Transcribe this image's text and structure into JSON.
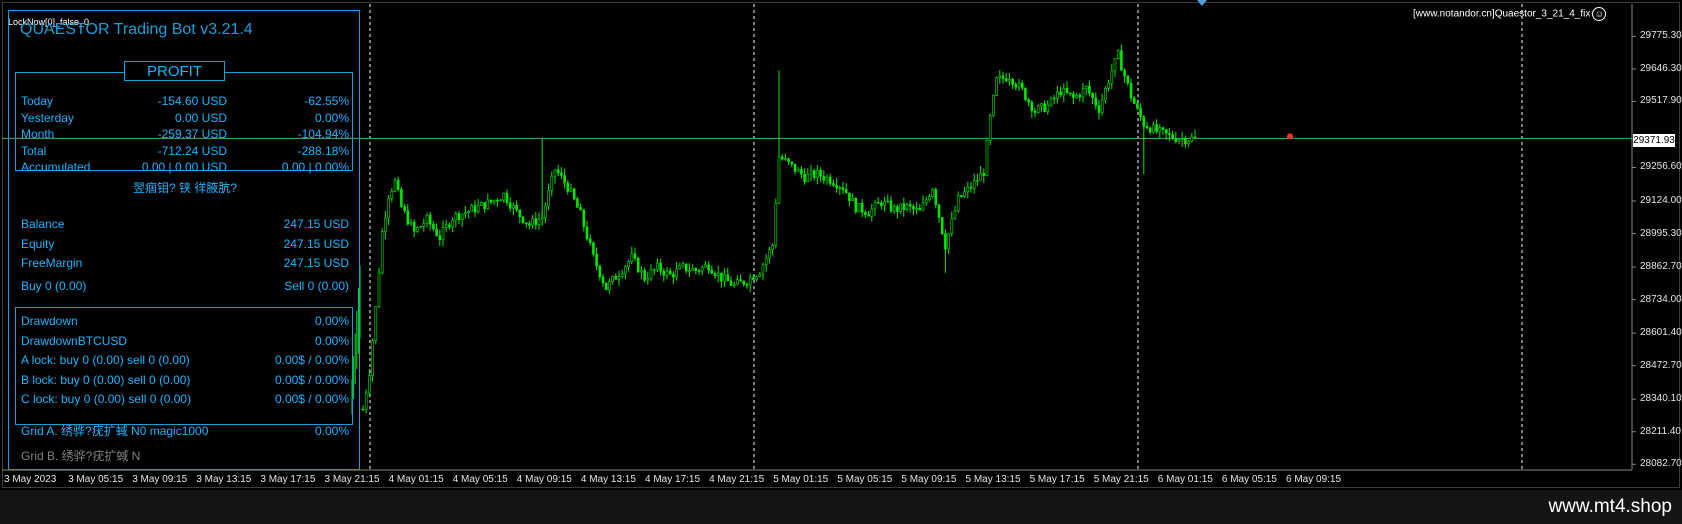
{
  "window": {
    "lock_status": "LockNow[0]_false_0",
    "top_right_label": "[www.notandor.cn]Quaestor_3_21_4_fix",
    "current_price": "29371.93",
    "watermark": "www.mt4.shop"
  },
  "panel": {
    "title": "QUAESTOR Trading Bot v3.21.4",
    "profit_header": "PROFIT",
    "profit_rows": [
      {
        "label": "Today",
        "value": "-154.60 USD",
        "percent": "-62.55%"
      },
      {
        "label": "Yesterday",
        "value": "0.00 USD",
        "percent": "0.00%"
      },
      {
        "label": "Month",
        "value": "-259.37 USD",
        "percent": "-104.94%"
      },
      {
        "label": "Total",
        "value": "-712.24 USD",
        "percent": "-288.18%"
      },
      {
        "label": "Accumulated",
        "value": "0.00 | 0.00 USD",
        "percent": "0.00 | 0.00%"
      }
    ],
    "garbled_line": "翌痼钼? 铗 徉腋肮?",
    "account_rows": [
      {
        "label": "Balance",
        "value": "247.15 USD"
      },
      {
        "label": "Equity",
        "value": "247.15 USD"
      },
      {
        "label": "FreeMargin",
        "value": "247.15 USD"
      }
    ],
    "buy_label": "Buy 0   (0.00)",
    "sell_label": "Sell 0   (0.00)",
    "drawdown_rows": [
      {
        "label": "Drawdown",
        "value": "0.00%"
      },
      {
        "label": "DrawdownBTCUSD",
        "value": "0.00%"
      },
      {
        "label": "A lock: buy 0 (0.00) sell 0 (0.00)",
        "value": "0.00$ / 0.00%"
      },
      {
        "label": "B lock: buy 0 (0.00) sell 0 (0.00)",
        "value": "0.00$ / 0.00%"
      },
      {
        "label": "C lock: buy 0 (0.00) sell 0 (0.00)",
        "value": "0.00$ / 0.00%"
      }
    ],
    "grid_a_label": "Grid A. 绣骅?疣扩蜮 N0 magic1000",
    "grid_a_value": "0.00%",
    "grid_b_label": "Grid B. 绣骅?疣扩蜮 N"
  },
  "colors": {
    "background": "#000000",
    "candle": "#00e600",
    "panel_text": "#1ab4ff",
    "panel_border": "#1a9ed8",
    "price_line": "#3cb371",
    "grid": "#ffffff"
  },
  "chart_data": {
    "type": "candlestick",
    "symbol_timeframe": "M15",
    "price_axis": [
      "29775.30",
      "29646.30",
      "29517.90",
      "29256.60",
      "29124.00",
      "28995.30",
      "28862.70",
      "28734.00",
      "28601.40",
      "28472.70",
      "28340.10",
      "28211.40",
      "28082.70"
    ],
    "time_axis": [
      "3 May 2023",
      "3 May 05:15",
      "3 May 09:15",
      "3 May 13:15",
      "3 May 17:15",
      "3 May 21:15",
      "4 May 01:15",
      "4 May 05:15",
      "4 May 09:15",
      "4 May 13:15",
      "4 May 17:15",
      "4 May 21:15",
      "5 May 01:15",
      "5 May 05:15",
      "5 May 09:15",
      "5 May 13:15",
      "5 May 17:15",
      "5 May 21:15",
      "6 May 01:15",
      "6 May 05:15",
      "6 May 09:15"
    ],
    "ylim": [
      28060,
      29840
    ],
    "current_price": 29371.93,
    "close_path": [
      [
        0,
        28300
      ],
      [
        2,
        28450
      ],
      [
        4,
        28700
      ],
      [
        6,
        29000
      ],
      [
        8,
        29150
      ],
      [
        10,
        29200
      ],
      [
        12,
        29100
      ],
      [
        16,
        29000
      ],
      [
        20,
        29050
      ],
      [
        24,
        28980
      ],
      [
        28,
        29060
      ],
      [
        32,
        29080
      ],
      [
        36,
        29100
      ],
      [
        40,
        29120
      ],
      [
        44,
        29150
      ],
      [
        48,
        29080
      ],
      [
        52,
        29030
      ],
      [
        56,
        29060
      ],
      [
        60,
        29250
      ],
      [
        64,
        29180
      ],
      [
        68,
        29070
      ],
      [
        72,
        28900
      ],
      [
        76,
        28780
      ],
      [
        80,
        28840
      ],
      [
        84,
        28900
      ],
      [
        88,
        28820
      ],
      [
        92,
        28860
      ],
      [
        96,
        28830
      ],
      [
        100,
        28860
      ],
      [
        104,
        28850
      ],
      [
        108,
        28870
      ],
      [
        112,
        28820
      ],
      [
        116,
        28790
      ],
      [
        120,
        28810
      ],
      [
        124,
        28850
      ],
      [
        128,
        28950
      ],
      [
        130,
        29300
      ],
      [
        134,
        29260
      ],
      [
        138,
        29220
      ],
      [
        142,
        29230
      ],
      [
        146,
        29210
      ],
      [
        150,
        29180
      ],
      [
        154,
        29100
      ],
      [
        158,
        29080
      ],
      [
        162,
        29120
      ],
      [
        166,
        29090
      ],
      [
        170,
        29100
      ],
      [
        174,
        29080
      ],
      [
        178,
        29180
      ],
      [
        182,
        28950
      ],
      [
        186,
        29130
      ],
      [
        190,
        29180
      ],
      [
        194,
        29240
      ],
      [
        196,
        29450
      ],
      [
        198,
        29600
      ],
      [
        202,
        29620
      ],
      [
        206,
        29560
      ],
      [
        210,
        29480
      ],
      [
        214,
        29500
      ],
      [
        218,
        29560
      ],
      [
        222,
        29530
      ],
      [
        226,
        29570
      ],
      [
        230,
        29490
      ],
      [
        234,
        29640
      ],
      [
        236,
        29700
      ],
      [
        238,
        29620
      ],
      [
        240,
        29540
      ],
      [
        242,
        29480
      ],
      [
        244,
        29430
      ],
      [
        248,
        29400
      ],
      [
        252,
        29380
      ],
      [
        256,
        29370
      ],
      [
        260,
        29372
      ]
    ]
  }
}
